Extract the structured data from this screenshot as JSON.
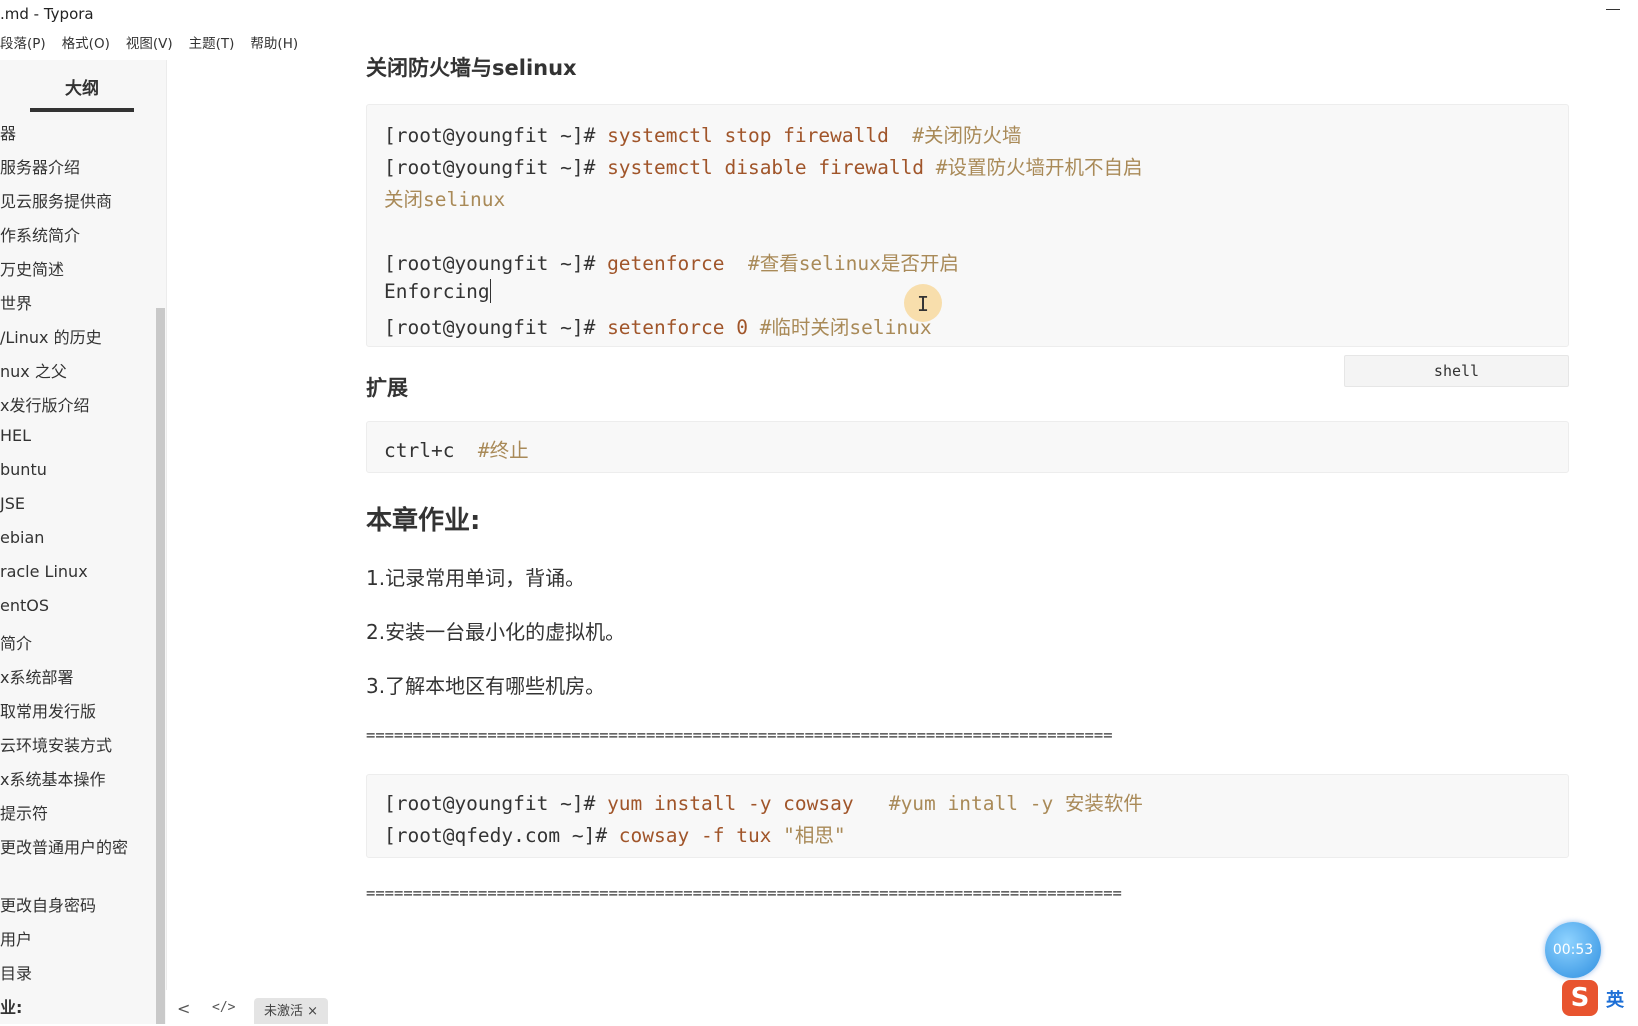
{
  "window": {
    "title": ".md - Typora"
  },
  "menubar": [
    "段落(P)",
    "格式(O)",
    "视图(V)",
    "主题(T)",
    "帮助(H)"
  ],
  "sidebar": {
    "title": "大纲",
    "items": [
      "器",
      "服务器介绍",
      "见云服务提供商",
      "作系统简介",
      "万史简述",
      "世界",
      "/Linux 的历史",
      "nux 之父",
      "x发行版介绍",
      "HEL",
      "buntu",
      "JSE",
      "ebian",
      "racle Linux",
      "entOS",
      "简介",
      "x系统部署",
      "取常用发行版",
      "云环境安装方式",
      "x系统基本操作",
      "提示符",
      "更改普通用户的密",
      "更改自身密码",
      "用户",
      "目录",
      "业:"
    ]
  },
  "bottom": {
    "back": "<",
    "source": "</>",
    "status": "未激活 ×"
  },
  "content": {
    "h_firewall": "关闭防火墙与selinux",
    "code1": [
      {
        "prompt": "[root@youngfit ~]#",
        "cmd": " systemctl stop firewalld",
        "cmt": "  #关闭防火墙"
      },
      {
        "prompt": "[root@youngfit ~]#",
        "cmd": " systemctl disable firewalld",
        "cmt": " #设置防火墙开机不自启"
      },
      {
        "prompt": "",
        "cmd": "",
        "cmt": "关闭selinux"
      },
      {
        "prompt": "[root@youngfit ~]#",
        "cmd": " getenforce",
        "cmt": "  #查看selinux是否开启"
      },
      {
        "prompt": "Enforcing",
        "cmd": "",
        "cmt": ""
      },
      {
        "prompt": "[root@youngfit ~]#",
        "cmd": " setenforce 0",
        "cmt": " #临时关闭selinux"
      }
    ],
    "code1_lang": "shell",
    "h_expand": "扩展",
    "code2": {
      "cmd": "ctrl+c",
      "cmt": "  #终止"
    },
    "h_homework": "本章作业:",
    "homework": [
      "1.记录常用单词，背诵。",
      "2.安装一台最小化的虚拟机。",
      "3.了解本地区有哪些机房。"
    ],
    "rule1": "================================================================================",
    "code3": [
      {
        "prompt": "[root@youngfit ~]#",
        "cmd": " yum install -y cowsay",
        "cmt": "   #yum intall -y 安装软件"
      },
      {
        "prompt": "[root@qfedy.com ~]#",
        "cmd": " cowsay -f tux",
        "cmt": " \"相思\""
      }
    ],
    "rule2": "================================================================================="
  },
  "overlay": {
    "timer": "00:53",
    "ime_logo": "S",
    "ime_lang": "英"
  },
  "colors": {
    "command": "#a0552a",
    "comment": "#a98a58",
    "sidebar_bg": "#f7f7f7",
    "code_bg": "#f8f8f8"
  }
}
